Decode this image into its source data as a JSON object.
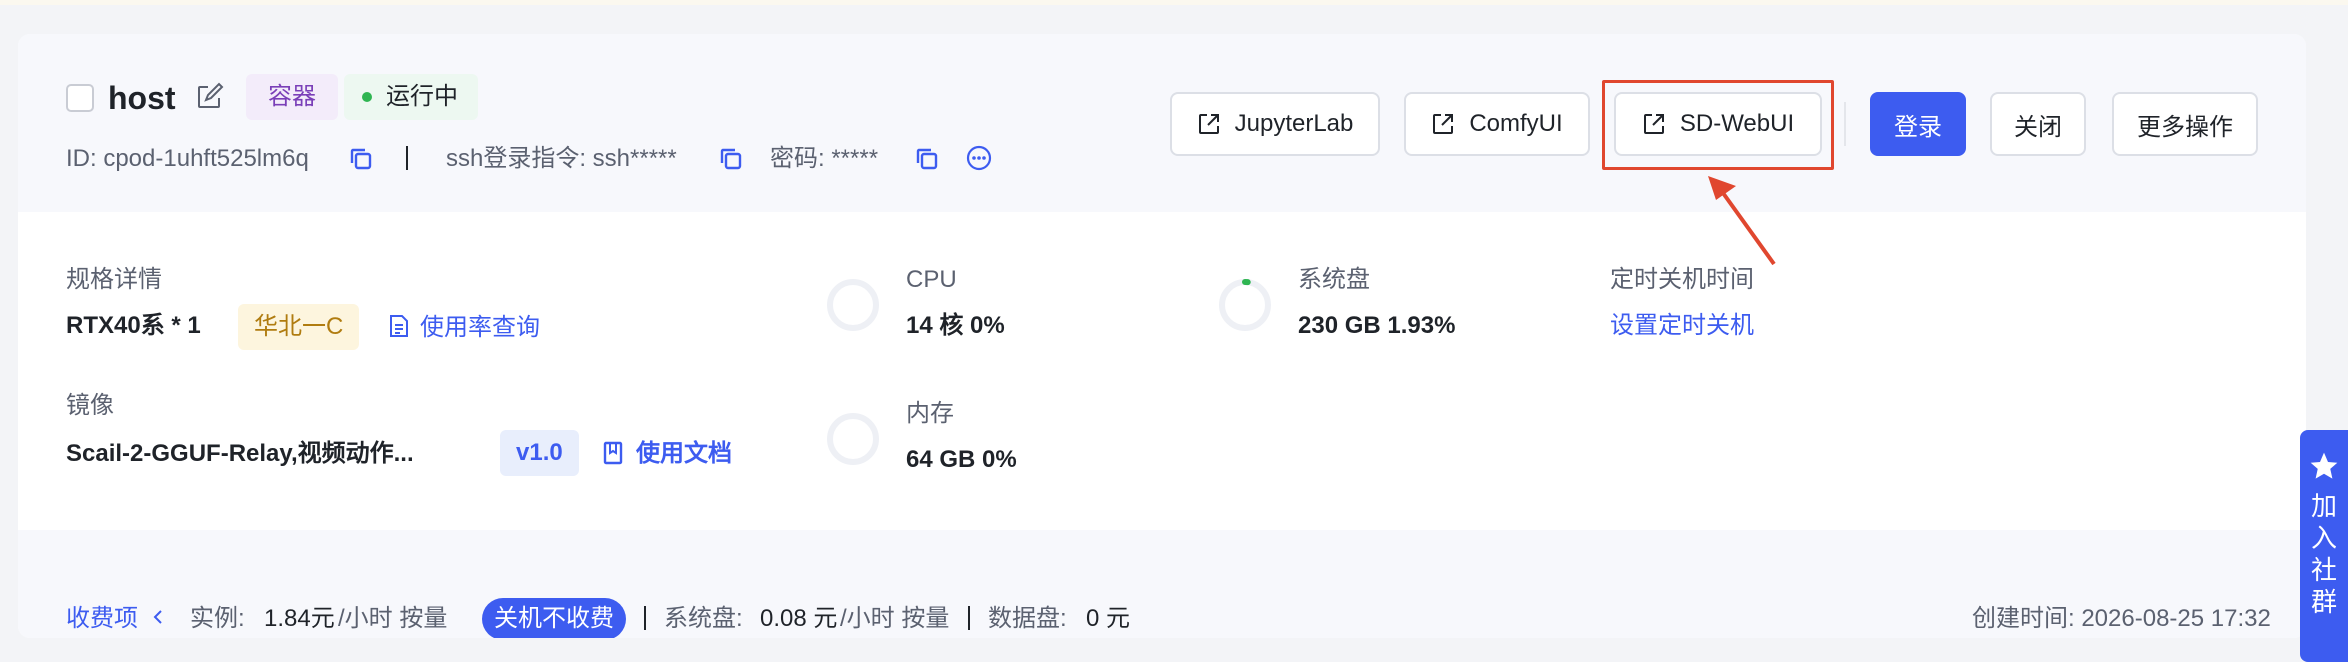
{
  "instance": {
    "name": "host",
    "type_tag": "容器",
    "status": "运行中",
    "id_text": "ID: cpod-1uhft525lm6q",
    "ssh_text": "ssh登录指令: ssh*****",
    "password_text": "密码: *****",
    "separator": "|"
  },
  "actions": {
    "jupyterlab": "JupyterLab",
    "comfyui": "ComfyUI",
    "sdwebui": "SD-WebUI",
    "login": "登录",
    "close": "关闭",
    "more": "更多操作"
  },
  "specs": {
    "label": "规格详情",
    "gpu": "RTX40系 * 1",
    "region": "华北一C",
    "usage_link": "使用率查询"
  },
  "image": {
    "label": "镜像",
    "name": "Scail-2-GGUF-Relay,视频动作...",
    "version": "v1.0",
    "docs_link": "使用文档"
  },
  "cpu": {
    "label": "CPU",
    "value": "14 核 0%",
    "usage": 0
  },
  "memory": {
    "label": "内存",
    "value": "64 GB 0%",
    "usage": 0
  },
  "disk": {
    "label": "系统盘",
    "value": "230 GB 1.93%",
    "usage": 1.93
  },
  "schedule": {
    "label": "定时关机时间",
    "link": "设置定时关机"
  },
  "billing": {
    "label": "收费项",
    "instance_label": "实例:",
    "instance_price": "1.84元",
    "instance_unit": "/小时 按量",
    "no_charge_badge": "关机不收费",
    "disk_label": "系统盘:",
    "disk_price": "0.08 元",
    "disk_unit": "/小时 按量",
    "data_disk_label": "数据盘:",
    "data_disk_price": "0 元",
    "created": "创建时间: 2026-08-25 17:32"
  },
  "community": {
    "label": "加入社群"
  },
  "colors": {
    "primary": "#3d5cf0",
    "highlight": "#e0472f",
    "status": "#2fb552"
  },
  "icons": [
    "edit-icon",
    "copy-icon",
    "more-icon",
    "external-link-icon",
    "document-icon",
    "book-icon",
    "chevron-left-icon",
    "star-icon"
  ]
}
